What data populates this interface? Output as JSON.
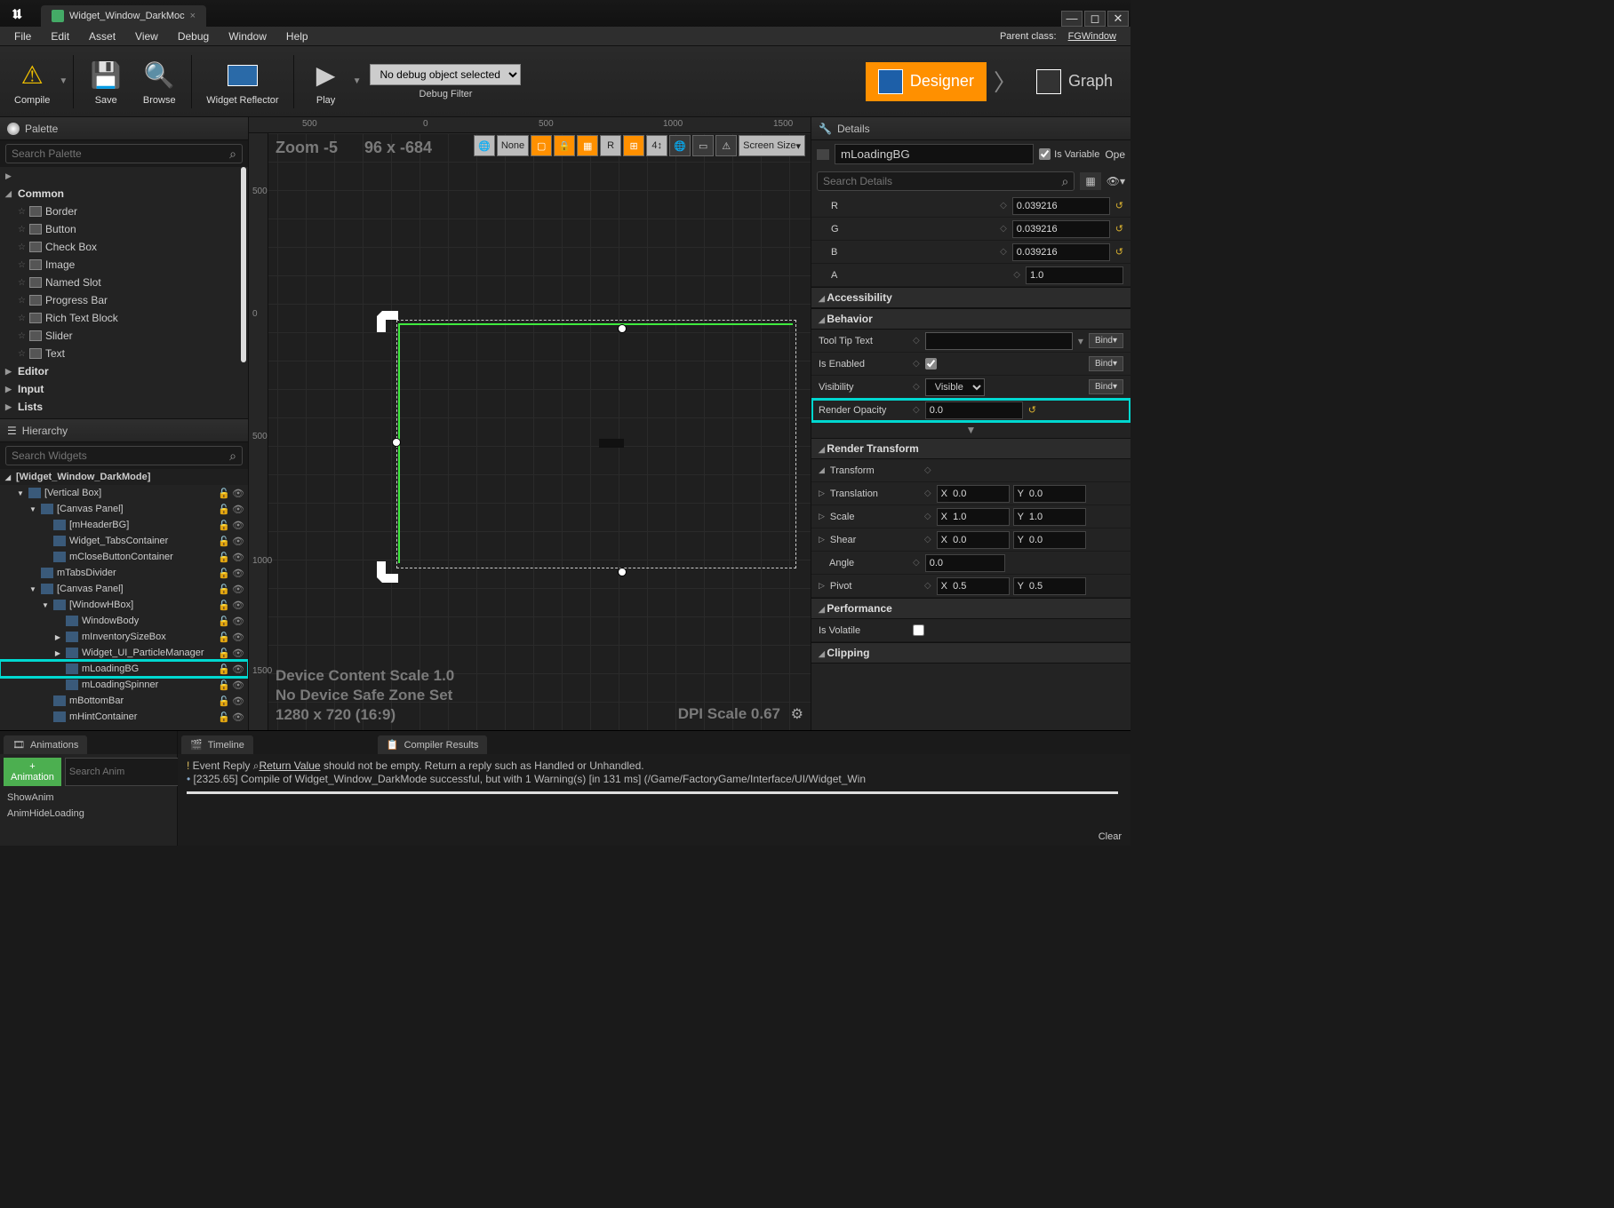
{
  "titlebar": {
    "doc_name": "Widget_Window_DarkMoc"
  },
  "menu": {
    "file": "File",
    "edit": "Edit",
    "asset": "Asset",
    "view": "View",
    "debug": "Debug",
    "window": "Window",
    "help": "Help",
    "parent_label": "Parent class:",
    "parent_value": "FGWindow"
  },
  "toolbar": {
    "compile": "Compile",
    "save": "Save",
    "browse": "Browse",
    "widget_reflector": "Widget Reflector",
    "play": "Play",
    "debug_selected": "No debug object selected",
    "debug_filter": "Debug Filter",
    "designer": "Designer",
    "graph": "Graph"
  },
  "palette": {
    "title": "Palette",
    "search_ph": "Search Palette",
    "common": "Common",
    "items": [
      "Border",
      "Button",
      "Check Box",
      "Image",
      "Named Slot",
      "Progress Bar",
      "Rich Text Block",
      "Slider",
      "Text"
    ],
    "editor": "Editor",
    "input": "Input",
    "lists": "Lists"
  },
  "hierarchy": {
    "title": "Hierarchy",
    "search_ph": "Search Widgets",
    "root": "[Widget_Window_DarkMode]",
    "rows": [
      {
        "d": 1,
        "t": "[Vertical Box]",
        "a": "▼"
      },
      {
        "d": 2,
        "t": "[Canvas Panel]",
        "a": "▼"
      },
      {
        "d": 3,
        "t": "[mHeaderBG]",
        "a": ""
      },
      {
        "d": 3,
        "t": "Widget_TabsContainer",
        "a": ""
      },
      {
        "d": 3,
        "t": "mCloseButtonContainer",
        "a": ""
      },
      {
        "d": 2,
        "t": "mTabsDivider",
        "a": ""
      },
      {
        "d": 2,
        "t": "[Canvas Panel]",
        "a": "▼"
      },
      {
        "d": 3,
        "t": "[WindowHBox]",
        "a": "▼"
      },
      {
        "d": 4,
        "t": "WindowBody",
        "a": ""
      },
      {
        "d": 4,
        "t": "mInventorySizeBox",
        "a": "▶"
      },
      {
        "d": 4,
        "t": "Widget_UI_ParticleManager",
        "a": "▶"
      },
      {
        "d": 4,
        "t": "mLoadingBG",
        "a": "",
        "sel": true
      },
      {
        "d": 4,
        "t": "mLoadingSpinner",
        "a": ""
      },
      {
        "d": 3,
        "t": "mBottomBar",
        "a": ""
      },
      {
        "d": 3,
        "t": "mHintContainer",
        "a": ""
      }
    ]
  },
  "viewport": {
    "zoom": "Zoom -5",
    "coord": "96 x -684",
    "none": "None",
    "screen_size": "Screen Size",
    "ruler_h": [
      "500",
      "0",
      "500",
      "1000",
      "1500"
    ],
    "ruler_v": [
      "500",
      "0",
      "500",
      "1000",
      "1500"
    ],
    "footer1": "Device Content Scale 1.0",
    "footer2": "No Device Safe Zone Set",
    "footer3": "1280 x 720 (16:9)",
    "dpi": "DPI Scale 0.67"
  },
  "details": {
    "title": "Details",
    "name": "mLoadingBG",
    "is_variable": "Is Variable",
    "open": "Ope",
    "search_ph": "Search Details",
    "color_r": "0.039216",
    "color_g": "0.039216",
    "color_b": "0.039216",
    "color_a": "1.0",
    "cat_access": "Accessibility",
    "cat_behavior": "Behavior",
    "tooltip": "Tool Tip Text",
    "is_enabled": "Is Enabled",
    "visibility": "Visibility",
    "visibility_val": "Visible",
    "render_opacity": "Render Opacity",
    "render_opacity_val": "0.0",
    "cat_rt": "Render Transform",
    "transform": "Transform",
    "translation": "Translation",
    "scale": "Scale",
    "shear": "Shear",
    "angle": "Angle",
    "pivot": "Pivot",
    "tx": "0.0",
    "ty": "0.0",
    "sx": "1.0",
    "sy": "1.0",
    "shx": "0.0",
    "shy": "0.0",
    "ang": "0.0",
    "px": "0.5",
    "py": "0.5",
    "cat_perf": "Performance",
    "is_volatile": "Is Volatile",
    "cat_clip": "Clipping",
    "bind": "Bind"
  },
  "animations": {
    "title": "Animations",
    "add": "+ Animation",
    "search_ph": "Search Anim",
    "items": [
      "ShowAnim",
      "AnimHideLoading"
    ]
  },
  "timeline": "Timeline",
  "compiler": {
    "title": "Compiler Results",
    "line1a": "Event Reply ",
    "line1b": "Return Value",
    "line1c": "  should not be empty.  Return a reply such as Handled or Unhandled.",
    "line2": "[2325.65] Compile of Widget_Window_DarkMode successful, but with 1 Warning(s) [in 131 ms] (/Game/FactoryGame/Interface/UI/Widget_Win",
    "clear": "Clear"
  }
}
